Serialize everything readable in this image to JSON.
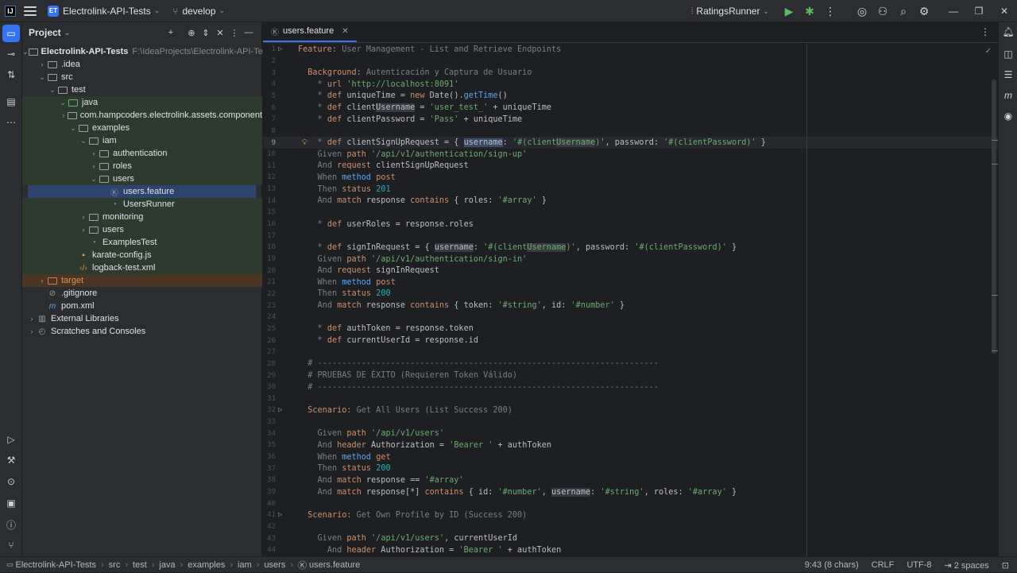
{
  "titlebar": {
    "project_badge": "ET",
    "project_name": "Electrolink-API-Tests",
    "branch": "develop",
    "run_config": "RatingsRunner"
  },
  "project_panel": {
    "title": "Project",
    "tree": [
      {
        "label": "Electrolink-API-Tests",
        "path": "F:\\IdeaProjects\\Electrolink-API-Tests",
        "depth": 0,
        "expanded": true,
        "icon": "module-folder-icon",
        "bold": true
      },
      {
        "label": ".idea",
        "depth": 1,
        "expanded": false,
        "icon": "folder-icon"
      },
      {
        "label": "src",
        "depth": 1,
        "expanded": true,
        "icon": "folder-icon"
      },
      {
        "label": "test",
        "depth": 2,
        "expanded": true,
        "icon": "folder-icon"
      },
      {
        "label": "java",
        "depth": 3,
        "expanded": true,
        "icon": "test-source-folder-icon",
        "bg": "green"
      },
      {
        "label": "com.hampcoders.electrolink.assets.component",
        "depth": 4,
        "expanded": false,
        "icon": "package-icon",
        "bg": "green"
      },
      {
        "label": "examples",
        "depth": 4,
        "expanded": true,
        "icon": "package-icon",
        "bg": "green"
      },
      {
        "label": "iam",
        "depth": 5,
        "expanded": true,
        "icon": "package-icon",
        "bg": "green"
      },
      {
        "label": "authentication",
        "depth": 6,
        "expanded": false,
        "icon": "package-icon",
        "bg": "green"
      },
      {
        "label": "roles",
        "depth": 6,
        "expanded": false,
        "icon": "package-icon",
        "bg": "green"
      },
      {
        "label": "users",
        "depth": 6,
        "expanded": true,
        "icon": "package-icon",
        "bg": "green"
      },
      {
        "label": "users.feature",
        "depth": 7,
        "icon": "karate-feature-icon",
        "bg": "selected"
      },
      {
        "label": "UsersRunner",
        "depth": 7,
        "icon": "test-class-icon",
        "bg": "green"
      },
      {
        "label": "monitoring",
        "depth": 5,
        "expanded": false,
        "icon": "package-icon",
        "bg": "green"
      },
      {
        "label": "users",
        "depth": 5,
        "expanded": false,
        "icon": "package-icon",
        "bg": "green"
      },
      {
        "label": "ExamplesTest",
        "depth": 5,
        "icon": "test-class-icon",
        "bg": "green"
      },
      {
        "label": "karate-config.js",
        "depth": 4,
        "icon": "js-file-icon",
        "bg": "green"
      },
      {
        "label": "logback-test.xml",
        "depth": 4,
        "icon": "xml-file-icon",
        "bg": "green"
      },
      {
        "label": "target",
        "depth": 1,
        "expanded": false,
        "icon": "excluded-folder-icon",
        "bg": "orange"
      },
      {
        "label": ".gitignore",
        "depth": 1,
        "icon": "gitignore-file-icon"
      },
      {
        "label": "pom.xml",
        "depth": 1,
        "icon": "maven-file-icon"
      },
      {
        "label": "External Libraries",
        "depth": 0,
        "expanded": false,
        "icon": "libraries-icon"
      },
      {
        "label": "Scratches and Consoles",
        "depth": 0,
        "expanded": false,
        "icon": "scratches-icon"
      }
    ]
  },
  "editor": {
    "tab_label": "users.feature",
    "current_line": 9,
    "lines": [
      {
        "n": "1",
        "run": true,
        "html": "<span class=\"kw\">Feature:</span> <span class=\"cmt\">User Management - List and Retrieve Endpoints</span>"
      },
      {
        "n": "2",
        "html": ""
      },
      {
        "n": "3",
        "html": "  <span class=\"kw\">Background:</span> <span class=\"cmt\">Autenticación y Captura de Usuario</span>"
      },
      {
        "n": "4",
        "html": "    <span class=\"cmt\">*</span> <span class=\"kw\">url</span> <span class=\"str\">'http://localhost:8091'</span>"
      },
      {
        "n": "5",
        "html": "    <span class=\"cmt\">*</span> <span class=\"kw\">def</span> uniqueTime = <span class=\"kw\">new</span> Date().<span class=\"fn\">getTime</span>()"
      },
      {
        "n": "6",
        "html": "    <span class=\"cmt\">*</span> <span class=\"kw\">def</span> client<span class=\"hl2\">Username</span> = <span class=\"str\">'user_test_'</span> + uniqueTime"
      },
      {
        "n": "7",
        "html": "    <span class=\"cmt\">*</span> <span class=\"kw\">def</span> clientPassword = <span class=\"str\">'Pass'</span> + uniqueTime"
      },
      {
        "n": "8",
        "html": ""
      },
      {
        "n": "9",
        "bulb": true,
        "html": "    <span class=\"cmt\">*</span> <span class=\"kw\">def</span> clientSignUpRequest = { <span class=\"hl\">username</span>: <span class=\"str\">'#(client<span class=\"hl2\">Username</span>)'</span>, password: <span class=\"str\">'#(clientPassword)'</span> }"
      },
      {
        "n": "10",
        "html": "    <span class=\"cmt\">Given</span> <span class=\"kw\">path</span> <span class=\"str\">'/api/v1/authentication/sign-up'</span>"
      },
      {
        "n": "11",
        "html": "    <span class=\"cmt\">And</span> <span class=\"kw\">request</span> clientSignUpRequest"
      },
      {
        "n": "12",
        "html": "    <span class=\"cmt\">When</span> <span class=\"fn\">method</span> <span class=\"kw\">post</span>"
      },
      {
        "n": "13",
        "html": "    <span class=\"cmt\">Then</span> <span class=\"kw\">status</span> <span class=\"num\">201</span>"
      },
      {
        "n": "14",
        "html": "    <span class=\"cmt\">And</span> <span class=\"kw\">match</span> response <span class=\"kw\">contains</span> { roles: <span class=\"str\">'#array'</span> }"
      },
      {
        "n": "15",
        "html": ""
      },
      {
        "n": "16",
        "html": "    <span class=\"cmt\">*</span> <span class=\"kw\">def</span> userRoles = response.roles"
      },
      {
        "n": "17",
        "html": ""
      },
      {
        "n": "18",
        "html": "    <span class=\"cmt\">*</span> <span class=\"kw\">def</span> signInRequest = { <span class=\"hl2\">username</span>: <span class=\"str\">'#(client<span class=\"hl2\">Username</span>)'</span>, password: <span class=\"str\">'#(clientPassword)'</span> }"
      },
      {
        "n": "19",
        "html": "    <span class=\"cmt\">Given</span> <span class=\"kw\">path</span> <span class=\"str\">'/api/v1/authentication/sign-in'</span>"
      },
      {
        "n": "20",
        "html": "    <span class=\"cmt\">And</span> <span class=\"kw\">request</span> signInRequest"
      },
      {
        "n": "21",
        "html": "    <span class=\"cmt\">When</span> <span class=\"fn\">method</span> <span class=\"kw\">post</span>"
      },
      {
        "n": "22",
        "html": "    <span class=\"cmt\">Then</span> <span class=\"kw\">status</span> <span class=\"num\">200</span>"
      },
      {
        "n": "23",
        "html": "    <span class=\"cmt\">And</span> <span class=\"kw\">match</span> response <span class=\"kw\">contains</span> { token: <span class=\"str\">'#string'</span>, id: <span class=\"str\">'#number'</span> }"
      },
      {
        "n": "24",
        "html": ""
      },
      {
        "n": "25",
        "html": "    <span class=\"cmt\">*</span> <span class=\"kw\">def</span> authToken = response.token"
      },
      {
        "n": "26",
        "html": "    <span class=\"cmt\">*</span> <span class=\"kw\">def</span> currentUserId = response.id"
      },
      {
        "n": "27",
        "html": ""
      },
      {
        "n": "28",
        "html": "  <span class=\"cmt\"># ----------------------------------------------------------------------</span>"
      },
      {
        "n": "29",
        "html": "  <span class=\"cmt\"># PRUEBAS DE ÉXITO (Requieren Token Válido)</span>"
      },
      {
        "n": "30",
        "html": "  <span class=\"cmt\"># ----------------------------------------------------------------------</span>"
      },
      {
        "n": "31",
        "html": ""
      },
      {
        "n": "32",
        "run": true,
        "html": "  <span class=\"kw\">Scenario:</span> <span class=\"cmt\">Get All Users (List Success 200)</span>"
      },
      {
        "n": "33",
        "html": ""
      },
      {
        "n": "34",
        "html": "    <span class=\"cmt\">Given</span> <span class=\"kw\">path</span> <span class=\"str\">'/api/v1/users'</span>"
      },
      {
        "n": "35",
        "html": "    <span class=\"cmt\">And</span> <span class=\"kw\">header</span> Authorization = <span class=\"str\">'Bearer '</span> + authToken"
      },
      {
        "n": "36",
        "html": "    <span class=\"cmt\">When</span> <span class=\"fn\">method</span> <span class=\"kw\">get</span>"
      },
      {
        "n": "37",
        "html": "    <span class=\"cmt\">Then</span> <span class=\"kw\">status</span> <span class=\"num\">200</span>"
      },
      {
        "n": "38",
        "html": "    <span class=\"cmt\">And</span> <span class=\"kw\">match</span> response == <span class=\"str\">'#array'</span>"
      },
      {
        "n": "39",
        "html": "    <span class=\"cmt\">And</span> <span class=\"kw\">match</span> response[*] <span class=\"kw\">contains</span> { id: <span class=\"str\">'#number'</span>, <span class=\"hl2\">username</span>: <span class=\"str\">'#string'</span>, roles: <span class=\"str\">'#array'</span> }"
      },
      {
        "n": "40",
        "html": ""
      },
      {
        "n": "41",
        "run": true,
        "html": "  <span class=\"kw\">Scenario:</span> <span class=\"cmt\">Get Own Profile by ID (Success 200)</span>"
      },
      {
        "n": "42",
        "html": ""
      },
      {
        "n": "43",
        "html": "    <span class=\"cmt\">Given</span> <span class=\"kw\">path</span> <span class=\"str\">'/api/v1/users'</span>, currentUserId"
      },
      {
        "n": "44",
        "html": "      <span class=\"cmt\">And</span> <span class=\"kw\">header</span> Authorization = <span class=\"str\">'Bearer '</span> + authToken"
      }
    ]
  },
  "statusbar": {
    "breadcrumbs": [
      "Electrolink-API-Tests",
      "src",
      "test",
      "java",
      "examples",
      "iam",
      "users",
      "users.feature"
    ],
    "position": "9:43 (8 chars)",
    "line_separator": "CRLF",
    "encoding": "UTF-8",
    "indent": "2 spaces"
  }
}
